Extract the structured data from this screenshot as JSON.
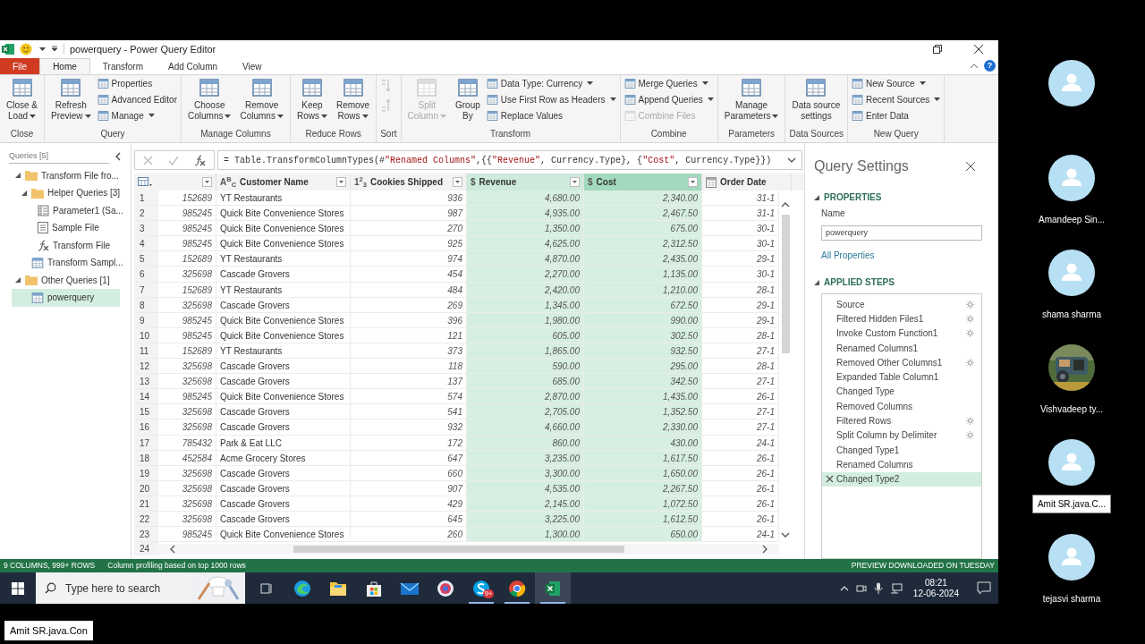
{
  "window": {
    "title": "powerquery - Power Query Editor"
  },
  "tabs": [
    {
      "label": "File",
      "kind": "file",
      "selected": false
    },
    {
      "label": "Home",
      "kind": "tab",
      "selected": true
    },
    {
      "label": "Transform",
      "kind": "tab",
      "selected": false
    },
    {
      "label": "Add Column",
      "kind": "tab",
      "selected": false
    },
    {
      "label": "View",
      "kind": "tab",
      "selected": false
    }
  ],
  "help": "?",
  "ribbon": [
    {
      "label": "Close",
      "items": [
        {
          "kind": "large",
          "label": "Close &\nLoad",
          "caret": true,
          "disabled": false
        }
      ]
    },
    {
      "label": "Query",
      "items": [
        {
          "kind": "large",
          "label": "Refresh\nPreview",
          "caret": true,
          "disabled": false
        },
        {
          "kind": "stack",
          "items": [
            {
              "label": "Properties",
              "caret": false,
              "disabled": false
            },
            {
              "label": "Advanced Editor",
              "caret": false,
              "disabled": false
            },
            {
              "label": "Manage",
              "caret": true,
              "disabled": false
            }
          ]
        }
      ]
    },
    {
      "label": "Manage Columns",
      "items": [
        {
          "kind": "large",
          "label": "Choose\nColumns",
          "caret": true,
          "disabled": false
        },
        {
          "kind": "large",
          "label": "Remove\nColumns",
          "caret": true,
          "disabled": false
        }
      ]
    },
    {
      "label": "Reduce Rows",
      "items": [
        {
          "kind": "large",
          "label": "Keep\nRows",
          "caret": true,
          "disabled": false
        },
        {
          "kind": "large",
          "label": "Remove\nRows",
          "caret": true,
          "disabled": false
        }
      ]
    },
    {
      "label": "Sort",
      "items": [
        {
          "kind": "sort",
          "disabled": true
        }
      ]
    },
    {
      "label": "Transform",
      "items": [
        {
          "kind": "large",
          "label": "Split\nColumn",
          "caret": true,
          "disabled": true
        },
        {
          "kind": "large",
          "label": "Group\nBy",
          "caret": false,
          "disabled": false
        },
        {
          "kind": "stack",
          "items": [
            {
              "label": "Data Type: Currency",
              "caret": true,
              "disabled": false
            },
            {
              "label": "Use First Row as Headers",
              "caret": true,
              "disabled": false
            },
            {
              "label": "Replace Values",
              "caret": false,
              "disabled": false
            }
          ]
        }
      ]
    },
    {
      "label": "Combine",
      "items": [
        {
          "kind": "stack",
          "items": [
            {
              "label": "Merge Queries",
              "caret": true,
              "disabled": false
            },
            {
              "label": "Append Queries",
              "caret": true,
              "disabled": false
            },
            {
              "label": "Combine Files",
              "caret": false,
              "disabled": true
            }
          ]
        }
      ]
    },
    {
      "label": "Parameters",
      "items": [
        {
          "kind": "large",
          "label": "Manage\nParameters",
          "caret": true,
          "disabled": false
        }
      ]
    },
    {
      "label": "Data Sources",
      "items": [
        {
          "kind": "large",
          "label": "Data source\nsettings",
          "caret": false,
          "disabled": false
        }
      ]
    },
    {
      "label": "New Query",
      "items": [
        {
          "kind": "stack",
          "items": [
            {
              "label": "New Source",
              "caret": true,
              "disabled": false
            },
            {
              "label": "Recent Sources",
              "caret": true,
              "disabled": false
            },
            {
              "label": "Enter Data",
              "caret": false,
              "disabled": false
            }
          ]
        }
      ]
    }
  ],
  "queries": {
    "title": "Queries [5]",
    "items": [
      {
        "label": "Transform File fro...",
        "kind": "folder",
        "expanded": true,
        "selected": false,
        "children": [
          {
            "label": "Helper Queries [3]",
            "kind": "folder",
            "expanded": true,
            "selected": false,
            "children": [
              {
                "label": "Parameter1 (Sa...",
                "kind": "parameter",
                "selected": false
              },
              {
                "label": "Sample File",
                "kind": "list",
                "selected": false
              },
              {
                "label": "Transform File",
                "kind": "function",
                "selected": false
              }
            ]
          },
          {
            "label": "Transform Sampl...",
            "kind": "table",
            "selected": false
          }
        ]
      },
      {
        "label": "Other Queries [1]",
        "kind": "folder",
        "expanded": true,
        "selected": false,
        "children": [
          {
            "label": "powerquery",
            "kind": "table",
            "selected": true
          }
        ]
      }
    ]
  },
  "formula": [
    {
      "text": "= Table.TransformColumnTypes(#",
      "kind": "code"
    },
    {
      "text": "\"Renamed Columns\"",
      "kind": "string"
    },
    {
      "text": ",{{",
      "kind": "code"
    },
    {
      "text": "\"Revenue\"",
      "kind": "string"
    },
    {
      "text": ", Currency.Type}, {",
      "kind": "code"
    },
    {
      "text": "\"Cost\"",
      "kind": "string"
    },
    {
      "text": ", Currency.Type}})",
      "kind": "code"
    }
  ],
  "table": {
    "columns": [
      {
        "kind": "any",
        "selected": false,
        "focused": false
      },
      {
        "title": "Customer Name",
        "kind": "text",
        "type_label": "A$^{B}$$_{C}$",
        "selected": false,
        "focused": false
      },
      {
        "title": "Cookies Shipped",
        "kind": "number",
        "type_label": "1$^{2}$$_{3}$",
        "selected": false,
        "focused": false
      },
      {
        "title": "Revenue",
        "kind": "currency",
        "type_label": "$",
        "selected": true,
        "focused": false
      },
      {
        "title": "Cost",
        "kind": "currency",
        "type_label": "$",
        "selected": true,
        "focused": true
      },
      {
        "title": "Order Date",
        "kind": "date",
        "selected": false,
        "focused": false
      }
    ],
    "rows": [
      {
        "n": "1",
        "cells": [
          "152689",
          "YT Restaurants",
          "936",
          "4,680.00",
          "2,340.00",
          "31-1"
        ]
      },
      {
        "n": "2",
        "cells": [
          "985245",
          "Quick Bite Convenience Stores",
          "987",
          "4,935.00",
          "2,467.50",
          "31-1"
        ]
      },
      {
        "n": "3",
        "cells": [
          "985245",
          "Quick Bite Convenience Stores",
          "270",
          "1,350.00",
          "675.00",
          "30-1"
        ]
      },
      {
        "n": "4",
        "cells": [
          "985245",
          "Quick Bite Convenience Stores",
          "925",
          "4,625.00",
          "2,312.50",
          "30-1"
        ]
      },
      {
        "n": "5",
        "cells": [
          "152689",
          "YT Restaurants",
          "974",
          "4,870.00",
          "2,435.00",
          "29-1"
        ]
      },
      {
        "n": "6",
        "cells": [
          "325698",
          "Cascade Grovers",
          "454",
          "2,270.00",
          "1,135.00",
          "30-1"
        ]
      },
      {
        "n": "7",
        "cells": [
          "152689",
          "YT Restaurants",
          "484",
          "2,420.00",
          "1,210.00",
          "28-1"
        ]
      },
      {
        "n": "8",
        "cells": [
          "325698",
          "Cascade Grovers",
          "269",
          "1,345.00",
          "672.50",
          "29-1"
        ]
      },
      {
        "n": "9",
        "cells": [
          "985245",
          "Quick Bite Convenience Stores",
          "396",
          "1,980.00",
          "990.00",
          "29-1"
        ]
      },
      {
        "n": "10",
        "cells": [
          "985245",
          "Quick Bite Convenience Stores",
          "121",
          "605.00",
          "302.50",
          "28-1"
        ]
      },
      {
        "n": "11",
        "cells": [
          "152689",
          "YT Restaurants",
          "373",
          "1,865.00",
          "932.50",
          "27-1"
        ]
      },
      {
        "n": "12",
        "cells": [
          "325698",
          "Cascade Grovers",
          "118",
          "590.00",
          "295.00",
          "28-1"
        ]
      },
      {
        "n": "13",
        "cells": [
          "325698",
          "Cascade Grovers",
          "137",
          "685.00",
          "342.50",
          "27-1"
        ]
      },
      {
        "n": "14",
        "cells": [
          "985245",
          "Quick Bite Convenience Stores",
          "574",
          "2,870.00",
          "1,435.00",
          "26-1"
        ]
      },
      {
        "n": "15",
        "cells": [
          "325698",
          "Cascade Grovers",
          "541",
          "2,705.00",
          "1,352.50",
          "27-1"
        ]
      },
      {
        "n": "16",
        "cells": [
          "325698",
          "Cascade Grovers",
          "932",
          "4,660.00",
          "2,330.00",
          "27-1"
        ]
      },
      {
        "n": "17",
        "cells": [
          "785432",
          "Park & Eat LLC",
          "172",
          "860.00",
          "430.00",
          "24-1"
        ]
      },
      {
        "n": "18",
        "cells": [
          "452584",
          "Acme Grocery Stores",
          "647",
          "3,235.00",
          "1,617.50",
          "26-1"
        ]
      },
      {
        "n": "19",
        "cells": [
          "325698",
          "Cascade Grovers",
          "660",
          "3,300.00",
          "1,650.00",
          "26-1"
        ]
      },
      {
        "n": "20",
        "cells": [
          "325698",
          "Cascade Grovers",
          "907",
          "4,535.00",
          "2,267.50",
          "26-1"
        ]
      },
      {
        "n": "21",
        "cells": [
          "325698",
          "Cascade Grovers",
          "429",
          "2,145.00",
          "1,072.50",
          "26-1"
        ]
      },
      {
        "n": "22",
        "cells": [
          "325698",
          "Cascade Grovers",
          "645",
          "3,225.00",
          "1,612.50",
          "26-1"
        ]
      },
      {
        "n": "23",
        "cells": [
          "985245",
          "Quick Bite Convenience Stores",
          "260",
          "1,300.00",
          "650.00",
          "24-1"
        ]
      }
    ],
    "next_row": "24"
  },
  "settings": {
    "title": "Query Settings",
    "properties": {
      "heading": "PROPERTIES",
      "expanded": true,
      "name_label": "Name",
      "name_value": "powerquery",
      "link": "All Properties"
    },
    "steps_section": {
      "heading": "APPLIED STEPS",
      "expanded": true
    },
    "steps": [
      {
        "label": "Source",
        "gear": true,
        "selected": false
      },
      {
        "label": "Filtered Hidden Files1",
        "gear": true,
        "selected": false
      },
      {
        "label": "Invoke Custom Function1",
        "gear": true,
        "selected": false
      },
      {
        "label": "Renamed Columns1",
        "gear": false,
        "selected": false
      },
      {
        "label": "Removed Other Columns1",
        "gear": true,
        "selected": false
      },
      {
        "label": "Expanded Table Column1",
        "gear": false,
        "selected": false
      },
      {
        "label": "Changed Type",
        "gear": false,
        "selected": false
      },
      {
        "label": "Removed Columns",
        "gear": false,
        "selected": false
      },
      {
        "label": "Filtered Rows",
        "gear": true,
        "selected": false
      },
      {
        "label": "Split Column by Delimiter",
        "gear": true,
        "selected": false
      },
      {
        "label": "Changed Type1",
        "gear": false,
        "selected": false
      },
      {
        "label": "Renamed Columns",
        "gear": false,
        "selected": false
      },
      {
        "label": "Changed Type2",
        "gear": false,
        "selected": true
      }
    ]
  },
  "status_bar": {
    "left": [
      "9 COLUMNS, 999+ ROWS",
      "Column profiling based on top 1000 rows"
    ],
    "right": "PREVIEW DOWNLOADED ON TUESDAY"
  },
  "taskbar": {
    "search_placeholder": "Type here to search",
    "apps": [
      {
        "running": false,
        "selected": false
      },
      {
        "running": false,
        "selected": false
      },
      {
        "running": false,
        "selected": false
      },
      {
        "running": false,
        "selected": false
      },
      {
        "running": false,
        "selected": false
      },
      {
        "running": false,
        "selected": false
      },
      {
        "running": true,
        "selected": false,
        "badge": "9+"
      },
      {
        "running": true,
        "selected": false
      },
      {
        "running": true,
        "selected": true
      }
    ],
    "time": "08:21",
    "date": "12-06-2024"
  },
  "participants": [
    {
      "kind": "avatar"
    },
    {
      "kind": "avatar",
      "name": "Amandeep Sin...",
      "hovered": false
    },
    {
      "kind": "avatar",
      "name": "shama sharma",
      "hovered": false
    },
    {
      "kind": "picture",
      "name": "Vishvadeep ty...",
      "hovered": false
    },
    {
      "kind": "avatar",
      "name": "Amit SR.java.C...",
      "hovered": true
    },
    {
      "kind": "avatar",
      "name": "tejasvi sharma",
      "hovered": false
    }
  ],
  "presenter": "Amit SR.java.Con"
}
